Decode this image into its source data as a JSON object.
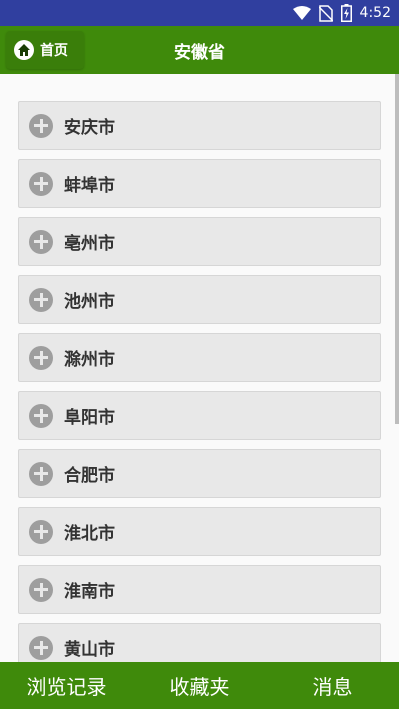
{
  "status": {
    "time": "4:52",
    "icons": [
      "wifi-icon",
      "no-sim-icon",
      "battery-icon"
    ]
  },
  "header": {
    "home_label": "首页",
    "title": "安徽省"
  },
  "cities": [
    {
      "label": "安庆市"
    },
    {
      "label": "蚌埠市"
    },
    {
      "label": "亳州市"
    },
    {
      "label": "池州市"
    },
    {
      "label": "滁州市"
    },
    {
      "label": "阜阳市"
    },
    {
      "label": "合肥市"
    },
    {
      "label": "淮北市"
    },
    {
      "label": "淮南市"
    },
    {
      "label": "黄山市"
    }
  ],
  "bottom_nav": {
    "history": "浏览记录",
    "favorites": "收藏夹",
    "messages": "消息"
  },
  "colors": {
    "status_bar": "#303f9f",
    "app_bar": "#3f8a0b",
    "item_bg": "#e8e8e8",
    "plus_icon": "#9e9e9e"
  }
}
